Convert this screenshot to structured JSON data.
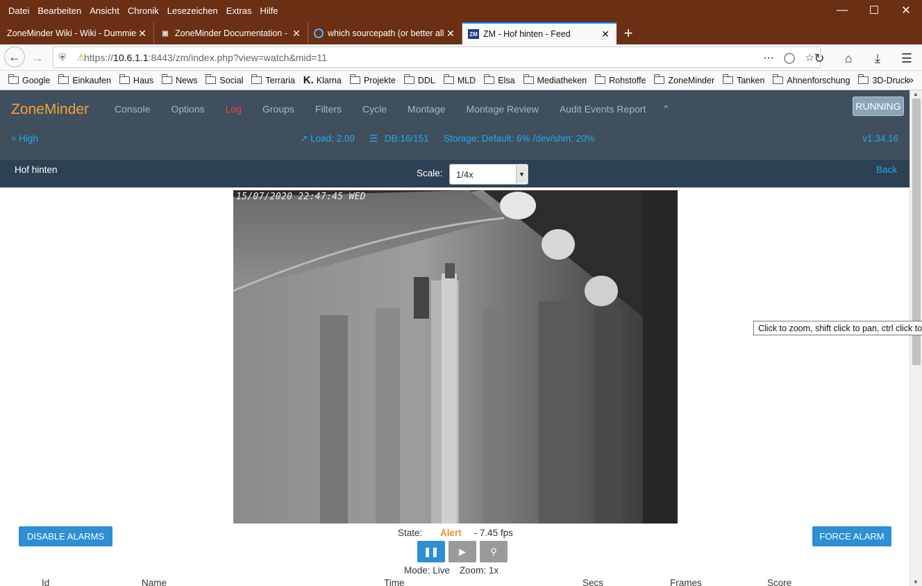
{
  "menu": [
    "Datei",
    "Bearbeiten",
    "Ansicht",
    "Chronik",
    "Lesezeichen",
    "Extras",
    "Hilfe"
  ],
  "tabs": [
    {
      "label": "ZoneMinder Wiki - Wiki - Dummies",
      "icon": "wiki-icon"
    },
    {
      "label": "ZoneMinder Documentation - ",
      "icon": "docs-icon"
    },
    {
      "label": "which sourcepath (or better all",
      "icon": "forum-icon"
    },
    {
      "label": "ZM - Hof hinten - Feed",
      "icon": "zm-icon",
      "active": true
    }
  ],
  "url": {
    "prefix": "https://",
    "host": "10.6.1.1",
    "rest": ":8443/zm/index.php?view=watch&mid=11"
  },
  "bookmarks": [
    "Google",
    "Einkaufen",
    "Haus",
    "News",
    "Social",
    "Terraria",
    "Klarna",
    "Projekte",
    "DDL",
    "MLD",
    "Elsa",
    "Mediatheken",
    "Rohstoffe",
    "ZoneMinder",
    "Tanken",
    "Ahnenforschung",
    "3D-Druck"
  ],
  "zm": {
    "brand": "ZoneMinder",
    "nav": [
      "Console",
      "Options",
      "Log",
      "Groups",
      "Filters",
      "Cycle",
      "Montage",
      "Montage Review",
      "Audit Events Report"
    ],
    "run_state": "RUNNING",
    "bandwidth": "High",
    "load": "Load: 2.09",
    "db": "DB:16/151",
    "storage": "Storage: Default: 6% /dev/shm: 20%",
    "version": "v1.34.16"
  },
  "monitor": {
    "name": "Hof hinten",
    "scale_label": "Scale:",
    "scale_value": "1/4x",
    "back": "Back",
    "timestamp": "15/07/2020 22:47:45 WED",
    "state_label": "State:",
    "state": "Alert",
    "fps": "- 7.45 fps",
    "disable_alarms": "DISABLE ALARMS",
    "force_alarm": "FORCE ALARM",
    "mode": "Mode: Live",
    "zoom": "Zoom: 1x",
    "tooltip": "Click to zoom, shift click to pan, ctrl click to z"
  },
  "events_table": {
    "columns": [
      "Id",
      "Name",
      "Time",
      "Secs",
      "Frames",
      "Score"
    ]
  },
  "colors": {
    "brand": "#f2a23b",
    "accent": "#27a7e8",
    "alert": "#ef8e1c",
    "log": "#e8453c",
    "button": "#2d8fd4"
  }
}
